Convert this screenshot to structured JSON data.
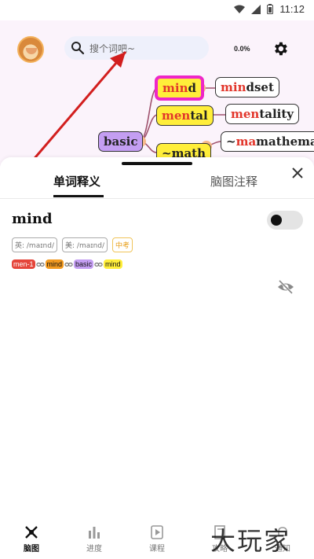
{
  "status_bar": {
    "time": "11:12"
  },
  "header": {
    "search_placeholder": "搜个词吧~",
    "progress_text": "0.0%"
  },
  "mindmap": {
    "nodes": [
      {
        "id": "mind",
        "prefix": "min",
        "rest": "d",
        "style": "yellow-active"
      },
      {
        "id": "mindset",
        "prefix": "min",
        "rest": "dset",
        "style": "white"
      },
      {
        "id": "mental",
        "prefix": "men",
        "rest": "tal",
        "style": "yellow"
      },
      {
        "id": "mentality",
        "prefix": "men",
        "rest": "tality",
        "style": "white"
      },
      {
        "id": "basic",
        "prefix": "",
        "rest": "basic",
        "style": "purple"
      },
      {
        "id": "math",
        "prefix": "",
        "rest": "~math",
        "style": "yellow"
      },
      {
        "id": "mathematics",
        "prefix": "~",
        "rest": "mathematics",
        "hl": "ma",
        "style": "white"
      }
    ]
  },
  "sheet": {
    "tabs": [
      "单词释义",
      "脑图注释"
    ],
    "word": "mind",
    "pron_uk": "英: /maɪnd/",
    "pron_us": "美: /maɪnd/",
    "level": "中考",
    "chips": [
      "men-1",
      "mind",
      "basic",
      "mind"
    ]
  },
  "nav": {
    "items": [
      "脑图",
      "进度",
      "课程",
      "攻略",
      "通知"
    ]
  },
  "watermark": "大玩家",
  "colors": {
    "accent_pink": "#ee27c8",
    "node_yellow": "#ffee3a",
    "node_purple": "#c49ef2",
    "highlight_red": "#e2362b"
  }
}
